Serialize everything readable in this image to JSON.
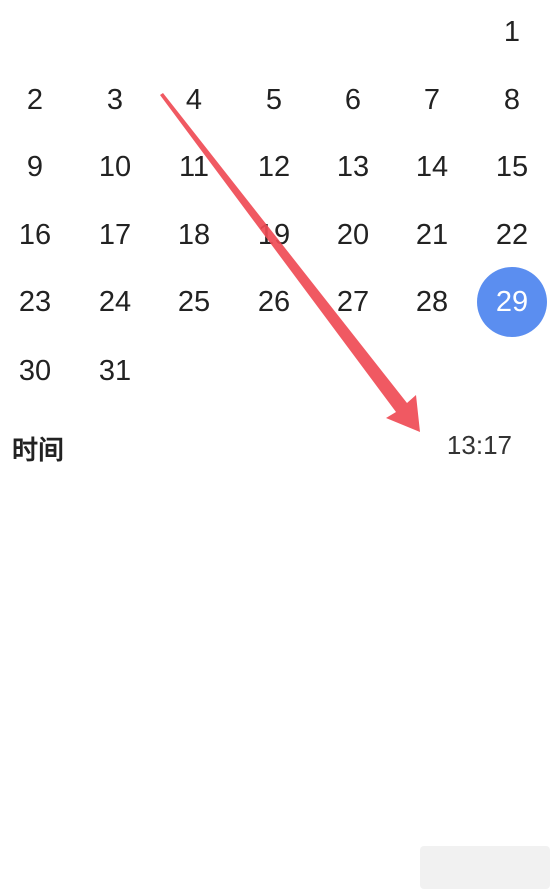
{
  "calendar": {
    "rows": [
      [
        "",
        "",
        "",
        "",
        "",
        "",
        "1"
      ],
      [
        "2",
        "3",
        "4",
        "5",
        "6",
        "7",
        "8"
      ],
      [
        "9",
        "10",
        "11",
        "12",
        "13",
        "14",
        "15"
      ],
      [
        "16",
        "17",
        "18",
        "19",
        "20",
        "21",
        "22"
      ],
      [
        "23",
        "24",
        "25",
        "26",
        "27",
        "28",
        "29"
      ],
      [
        "30",
        "31",
        "",
        "",
        "",
        "",
        ""
      ]
    ],
    "selected_day": "29",
    "selected_color": "#5b8ef0"
  },
  "time": {
    "label": "时间",
    "value": "13:17"
  },
  "annotation": {
    "arrow_color": "#ef4b55"
  }
}
